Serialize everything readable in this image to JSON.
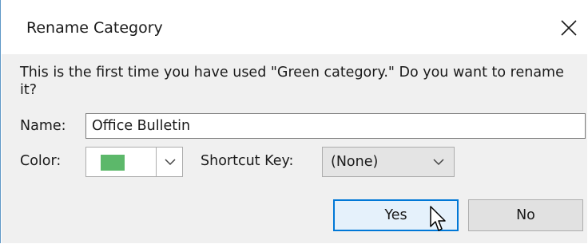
{
  "dialog": {
    "title": "Rename Category",
    "message": "This is the first time you have used \"Green category.\" Do you want to rename it?",
    "name_label": "Name:",
    "name_value": "Office Bulletin",
    "color_label": "Color:",
    "color_swatch": "#5cb86a",
    "shortcut_label": "Shortcut Key:",
    "shortcut_value": "(None)",
    "yes_label": "Yes",
    "no_label": "No"
  },
  "icons": {
    "close": "close-icon",
    "color_dropdown": "chevron-down-icon",
    "shortcut_dropdown": "chevron-down-icon",
    "cursor": "mouse-pointer-icon"
  },
  "colors": {
    "accent": "#0078d7",
    "content_bg": "#f0f0f0",
    "window_border": "#5f98c7"
  }
}
